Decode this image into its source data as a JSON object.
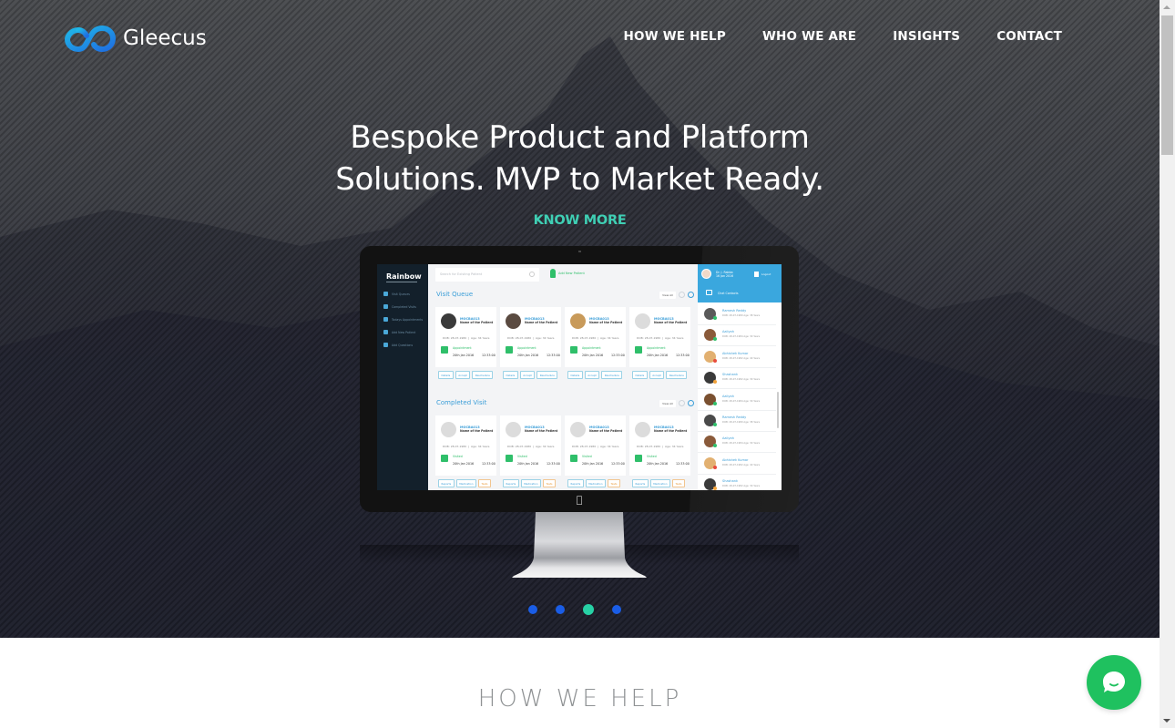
{
  "brand": {
    "name": "Gleecus"
  },
  "nav": {
    "items": [
      {
        "label": "HOW WE HELP"
      },
      {
        "label": "WHO WE ARE"
      },
      {
        "label": "INSIGHTS"
      },
      {
        "label": "CONTACT"
      }
    ]
  },
  "hero": {
    "headline_line1": "Bespoke Product and Platform",
    "headline_line2": "Solutions. MVP to Market Ready.",
    "cta_label": "KNOW MORE",
    "slider": {
      "count": 4,
      "active_index": 2
    }
  },
  "mockup": {
    "app_name": "Rainbow",
    "sidebar": [
      {
        "label": "Visit Queues"
      },
      {
        "label": "Completed Visits"
      },
      {
        "label": "Todays Appointments"
      },
      {
        "label": "Add New Patient"
      },
      {
        "label": "Add Questions"
      }
    ],
    "search_placeholder": "Search for Existing Patient",
    "add_patient_label": "Add New Patient",
    "visit_queue": {
      "title": "Visit Queue",
      "view_all": "View All",
      "cards": [
        {
          "id": "MOCBA013",
          "name": "Name of the Patient",
          "dob": "DOB: 28-07-1980",
          "age": "Age: 34 Years",
          "status": "Appointment",
          "date": "20th Jan 2016",
          "time": "12:33:00",
          "buttons": [
            "Details",
            "Accept",
            "Reschedule"
          ]
        },
        {
          "id": "MOCBA013",
          "name": "Name of the Patient",
          "dob": "DOB: 28-07-1980",
          "age": "Age: 34 Years",
          "status": "Appointment",
          "date": "20th Jan 2016",
          "time": "12:33:00",
          "buttons": [
            "Details",
            "Accept",
            "Reschedule"
          ]
        },
        {
          "id": "MOCBA013",
          "name": "Name of the Patient",
          "dob": "DOB: 28-07-1980",
          "age": "Age: 34 Years",
          "status": "Appointment",
          "date": "20th Jan 2016",
          "time": "12:33:00",
          "buttons": [
            "Details",
            "Accept",
            "Reschedule"
          ]
        },
        {
          "id": "MOCBA013",
          "name": "Name of the Patient",
          "dob": "DOB: 28-07-1980",
          "age": "Age: 34 Years",
          "status": "Appointment",
          "date": "20th Jan 2016",
          "time": "12:33:00",
          "buttons": [
            "Details",
            "Accept",
            "Reschedule"
          ]
        }
      ]
    },
    "completed_visit": {
      "title": "Completed Visit",
      "view_all": "View All",
      "cards": [
        {
          "id": "MOCBA013",
          "name": "Name of the Patient",
          "dob": "DOB: 28-07-1980",
          "age": "Age: 34 Years",
          "status": "Visited",
          "date": "20th Jan 2016",
          "time": "12:33:00",
          "buttons": [
            "Reports",
            "Medication",
            "Tests"
          ]
        },
        {
          "id": "MOCBA013",
          "name": "Name of the Patient",
          "dob": "DOB: 28-07-1980",
          "age": "Age: 34 Years",
          "status": "Visited",
          "date": "20th Jan 2016",
          "time": "12:33:00",
          "buttons": [
            "Reports",
            "Medication",
            "Tests"
          ]
        },
        {
          "id": "MOCBA013",
          "name": "Name of the Patient",
          "dob": "DOB: 28-07-1980",
          "age": "Age: 34 Years",
          "status": "Visited",
          "date": "20th Jan 2016",
          "time": "12:33:00",
          "buttons": [
            "Reports",
            "Medication",
            "Tests"
          ]
        },
        {
          "id": "MOCBA013",
          "name": "Name of the Patient",
          "dob": "DOB: 28-07-1980",
          "age": "Age: 34 Years",
          "status": "Visited",
          "date": "20th Jan 2016",
          "time": "12:33:00",
          "buttons": [
            "Reports",
            "Medication",
            "Tests"
          ]
        }
      ]
    },
    "chat": {
      "doctor_name": "Dr. J. Rabba",
      "doctor_sub": "16 Jan 2016",
      "logout_label": "Logout",
      "contacts_label": "Chat Contacts",
      "contacts": [
        {
          "name": "Ramesh Reddy",
          "meta": "DOB: 28-07-1980  Age: 38 Years",
          "status": "#2fbf6a"
        },
        {
          "name": "Aaliyah",
          "meta": "DOB: 28-07-1984  Age: 30 Years",
          "status": "#2fbf6a"
        },
        {
          "name": "Abhishek Kumar",
          "meta": "DOB: 28-07-1982  Age: 40 Years",
          "status": "#e84c3d"
        },
        {
          "name": "Shashank",
          "meta": "DOB: 28-07-1982  Age: 30 Years",
          "status": "#f2a23a"
        },
        {
          "name": "Aaliyah",
          "meta": "DOB: 28-07-1984  Age: 30 Years",
          "status": "#2fbf6a"
        },
        {
          "name": "Ramesh Reddy",
          "meta": "DOB: 28-07-1980  Age: 38 Years",
          "status": "#2fbf6a"
        },
        {
          "name": "Aaliyah",
          "meta": "DOB: 28-07-1984  Age: 30 Years",
          "status": "#2fbf6a"
        },
        {
          "name": "Abhishek Kumar",
          "meta": "DOB: 28-07-1982  Age: 40 Years",
          "status": "#e84c3d"
        },
        {
          "name": "Shashank",
          "meta": "DOB: 28-07-1982  Age: 30 Years",
          "status": "#f2a23a"
        }
      ]
    }
  },
  "section": {
    "title": "HOW WE HELP"
  },
  "colors": {
    "accent_teal": "#3fcfb4",
    "slider_dot": "#1a5de6",
    "slider_dot_active": "#27d1a5",
    "chat_widget": "#1fc15f"
  }
}
